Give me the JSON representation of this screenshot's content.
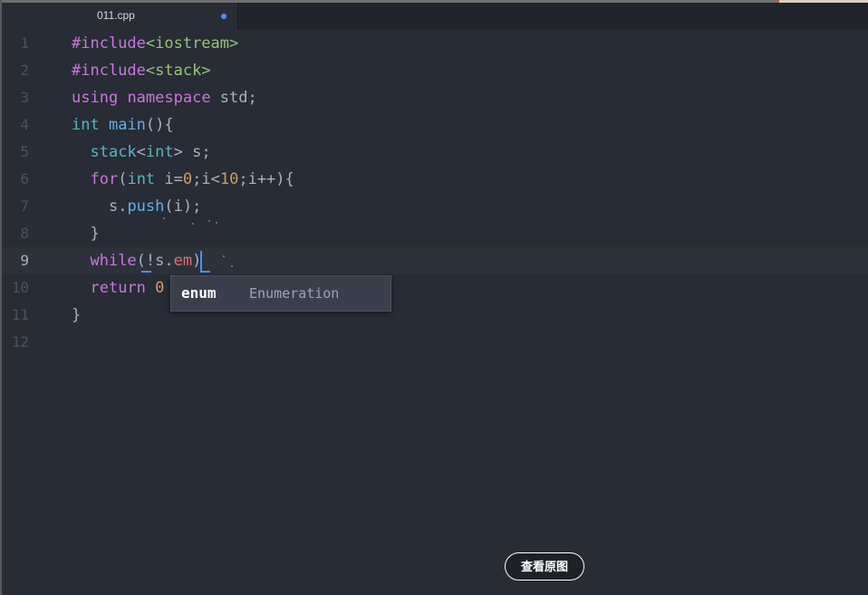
{
  "tab": {
    "title": "011.cpp",
    "modified": true
  },
  "colors": {
    "background": "#282c34",
    "keyword": "#c678dd",
    "type": "#56b6c2",
    "string": "#98c379",
    "function": "#61afef",
    "number": "#d19a66",
    "member": "#e06c75",
    "cursor": "#528bff"
  },
  "editor": {
    "line_numbers": [
      "1",
      "2",
      "3",
      "4",
      "5",
      "6",
      "7",
      "8",
      "9",
      "10",
      "11",
      "12"
    ],
    "active_line": "9",
    "code": {
      "l1": {
        "directive": "#include",
        "header": "<iostream>"
      },
      "l2": {
        "directive": "#include",
        "header": "<stack>"
      },
      "l3": {
        "kw_using": "using",
        "kw_namespace": "namespace",
        "name": " std;"
      },
      "l4": {
        "type": "int",
        "func": "main",
        "rest": "(){"
      },
      "l5": {
        "indent": "  ",
        "stack": "stack",
        "lt": "<",
        "type": "int",
        "gt": ">",
        "rest": " s;"
      },
      "l6": {
        "indent": "  ",
        "kw": "for",
        "p1": "(",
        "type": "int",
        "p2": " i=",
        "num0": "0",
        "p3": ";i<",
        "num10": "10",
        "p4": ";i++){"
      },
      "l7": {
        "indent": "    ",
        "obj": "s.",
        "method": "push",
        "rest": "(i);"
      },
      "l8": {
        "indent": "  ",
        "brace": "}"
      },
      "l9": {
        "indent": "  ",
        "kw": "while",
        "open": "(",
        "neg": "!s.",
        "typed": "em",
        "close": ")"
      },
      "l10": {
        "indent": "  ",
        "kw": "return",
        "space": " ",
        "num": "0"
      },
      "l11": {
        "brace": "}"
      }
    }
  },
  "autocomplete": {
    "suggestion": "enum",
    "description": "Enumeration"
  },
  "overlay_button": {
    "label": "查看原图"
  }
}
